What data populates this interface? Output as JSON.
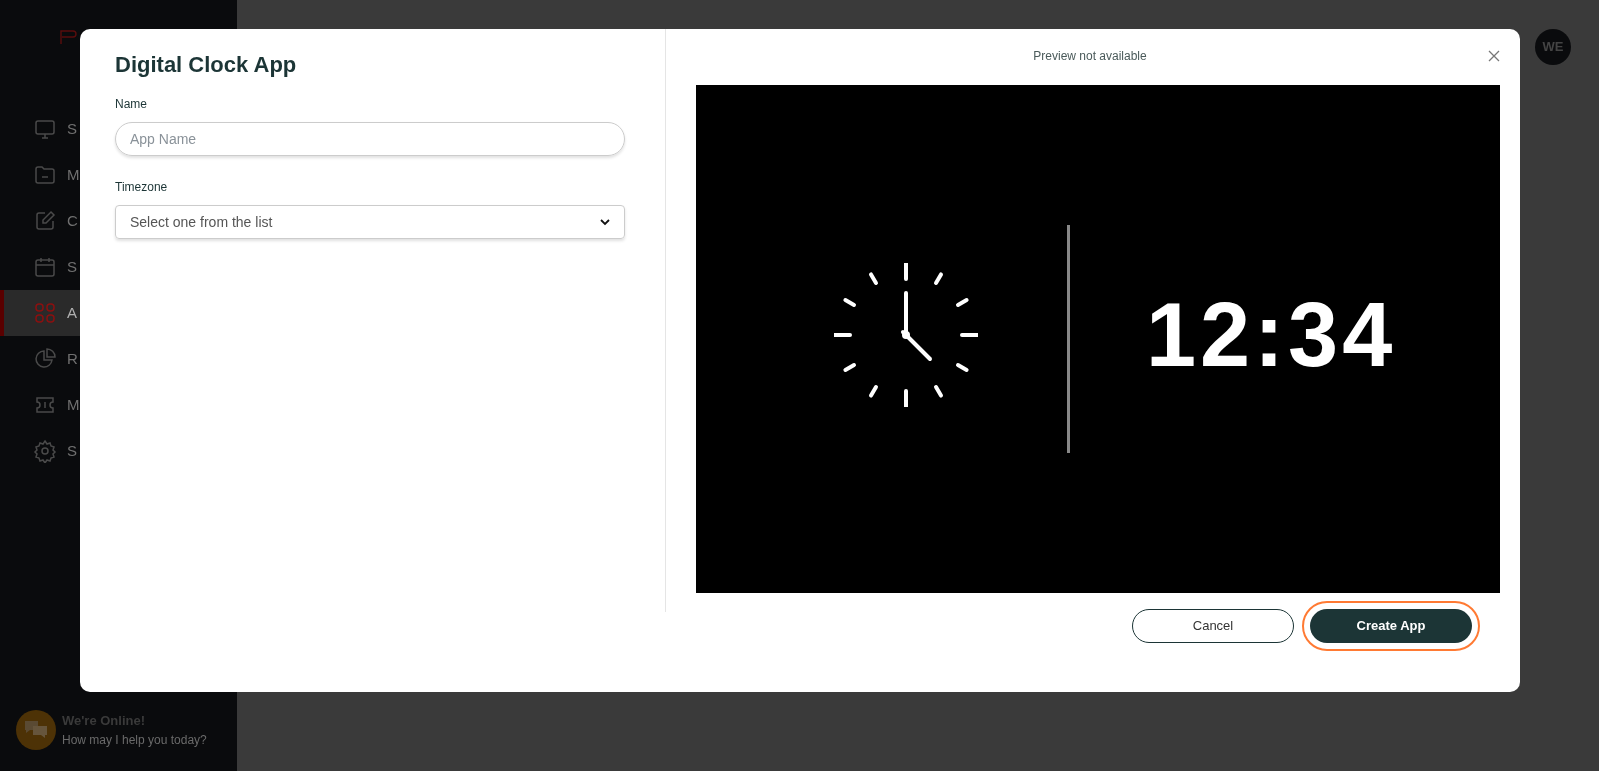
{
  "sidebar": {
    "items": [
      {
        "kind": "monitor",
        "label": "S",
        "selected": false
      },
      {
        "kind": "folder",
        "label": "M",
        "selected": false
      },
      {
        "kind": "edit",
        "label": "C",
        "selected": false
      },
      {
        "kind": "calendar",
        "label": "S",
        "selected": false
      },
      {
        "kind": "grid",
        "label": "A",
        "selected": true
      },
      {
        "kind": "pie",
        "label": "R",
        "selected": false
      },
      {
        "kind": "ticket",
        "label": "M",
        "selected": false
      },
      {
        "kind": "gear",
        "label": "S",
        "selected": false
      }
    ]
  },
  "avatar": {
    "initials": "WE"
  },
  "chat_widget": {
    "title": "We're Online!",
    "subtitle": "How may I help you today?"
  },
  "dialog": {
    "title": "Digital Clock App",
    "preview_note": "Preview not available",
    "fields": [
      {
        "kind": "text",
        "label": "Name",
        "placeholder": "App Name"
      },
      {
        "kind": "select",
        "label": "Timezone",
        "placeholder": "Select one from the list"
      }
    ],
    "preview": {
      "digital_time": "12:34"
    },
    "buttons": [
      {
        "kind": "secondary",
        "label": "Cancel",
        "highlighted": false
      },
      {
        "kind": "primary",
        "label": "Create App",
        "highlighted": true
      }
    ]
  }
}
